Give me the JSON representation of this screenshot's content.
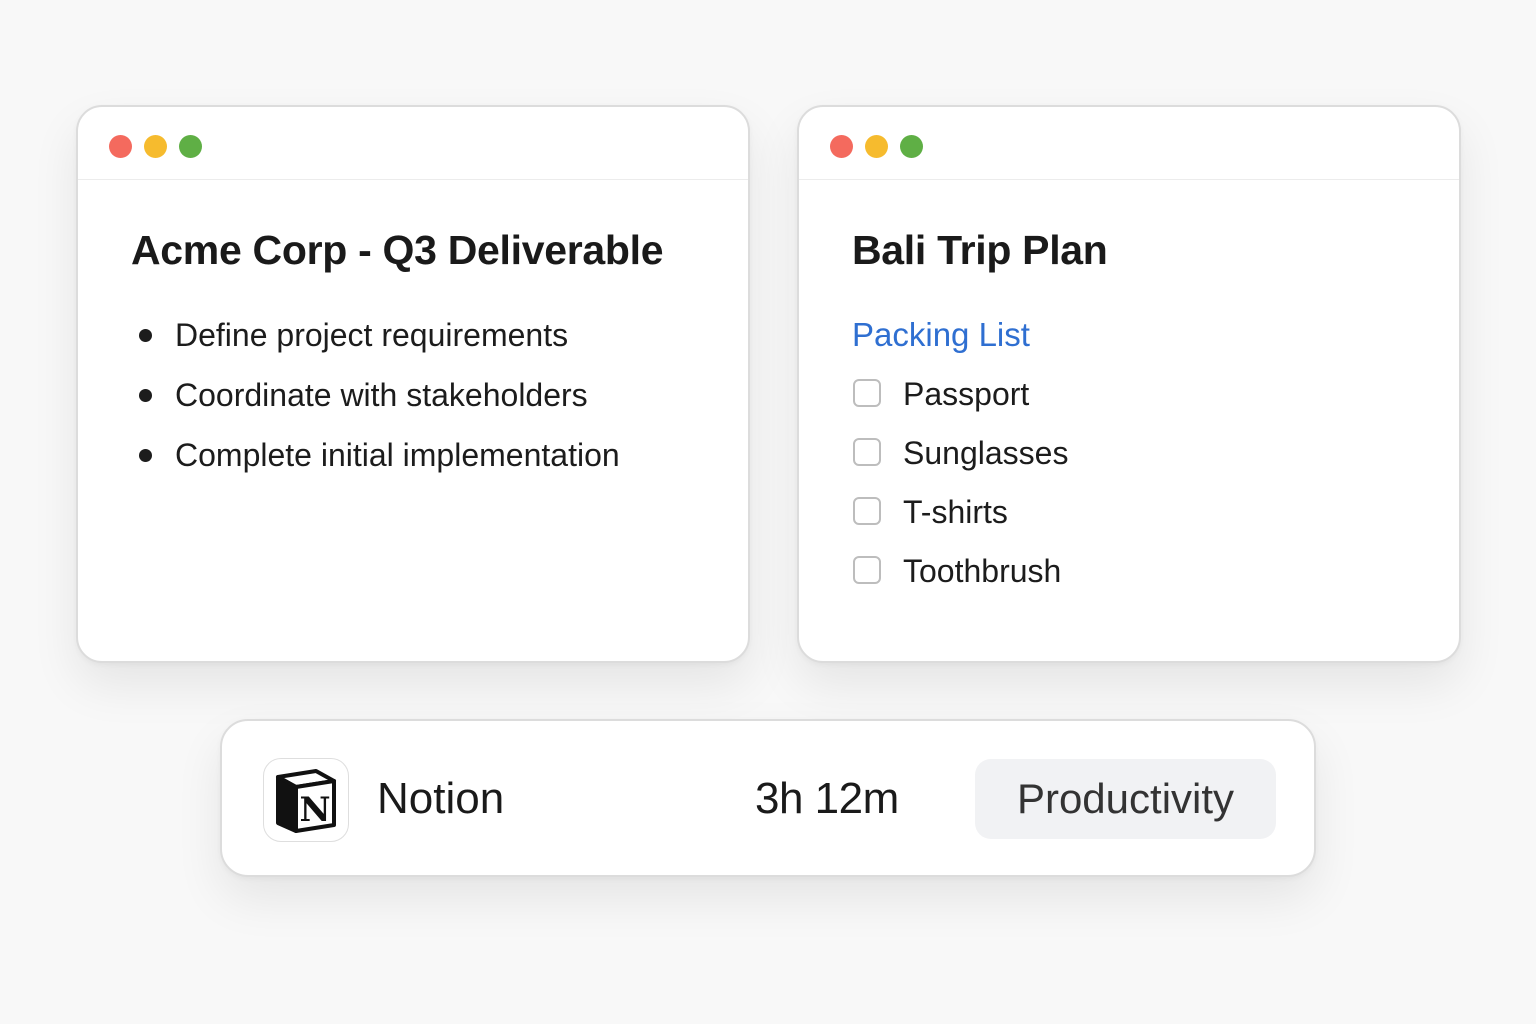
{
  "windows": {
    "acme": {
      "title": "Acme Corp - Q3 Deliverable",
      "items": [
        "Define project requirements",
        "Coordinate with stakeholders",
        "Complete initial implementation"
      ]
    },
    "bali": {
      "title": "Bali Trip Plan",
      "section_heading": "Packing List",
      "checklist": [
        "Passport",
        "Sunglasses",
        "T-shirts",
        "Toothbrush"
      ]
    }
  },
  "window_controls": {
    "close_color": "#f46a5e",
    "minimize_color": "#f6bb2e",
    "zoom_color": "#5faf45"
  },
  "usage": {
    "app_icon": "notion-logo-icon",
    "app_name": "Notion",
    "time": "3h 12m",
    "category": "Productivity"
  },
  "colors": {
    "accent_link": "#2f6fd1",
    "tag_background": "#f1f2f4"
  }
}
